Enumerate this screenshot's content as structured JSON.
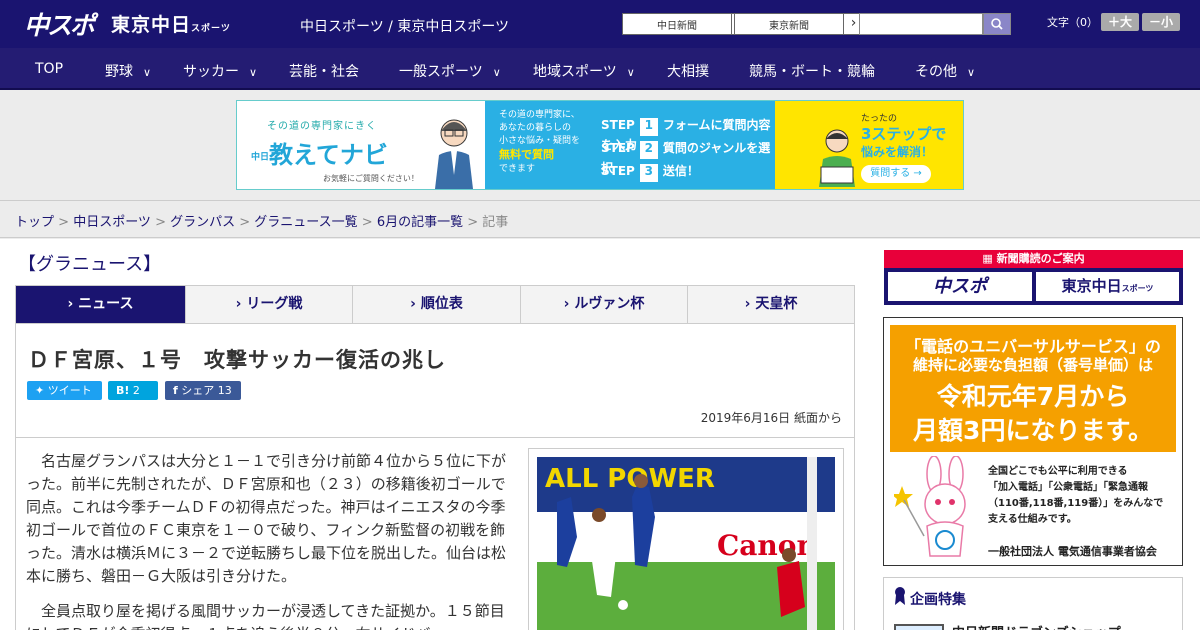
{
  "header": {
    "logo_main": "中スポ",
    "logo_tokyo": "東京中日",
    "logo_tokyo_small": "スポーツ",
    "site_title": "中日スポーツ / 東京中日スポーツ",
    "links": [
      {
        "label": "中日新聞"
      },
      {
        "label": "東京新聞"
      }
    ],
    "search": {
      "placeholder": ""
    },
    "font_size": {
      "label": "文字（0）",
      "bigger": "＋大",
      "smaller": "－小"
    }
  },
  "nav": {
    "items": [
      {
        "label": "TOP"
      },
      {
        "label": "野球"
      },
      {
        "label": "サッカー"
      },
      {
        "label": "芸能・社会"
      },
      {
        "label": "一般スポーツ"
      },
      {
        "label": "地域スポーツ"
      },
      {
        "label": "大相撲"
      },
      {
        "label": "競馬・ボート・競輪"
      },
      {
        "label": "その他"
      }
    ]
  },
  "banner": {
    "sub": "その道の専門家にきく",
    "logo_prefix": "中日",
    "logo": "教えてナビ",
    "note": "お気軽にご質問ください！",
    "desc_lines": [
      "その道の専門家に、",
      "あなたの暮らしの",
      "小さな悩み・疑問を"
    ],
    "desc_highlight": "無料で質問",
    "desc_end": "できます",
    "steps": [
      {
        "word": "STEP",
        "num": "1",
        "text": "フォームに質問内容を入力"
      },
      {
        "word": "STEP",
        "num": "2",
        "text": "質問のジャンルを選択"
      },
      {
        "word": "STEP",
        "num": "3",
        "text": "送信！"
      }
    ],
    "right_small": "たったの",
    "right_big": "3ステップで",
    "right_mid": "悩みを解消！",
    "right_button": "質問する →"
  },
  "breadcrumb": {
    "items": [
      "トップ",
      "中日スポーツ",
      "グランパス",
      "グラニュース一覧",
      "6月の記事一覧"
    ],
    "current": "記事",
    "sep": " > "
  },
  "section": {
    "title": "【グラニュース】"
  },
  "tabs": [
    {
      "label": "ニュース",
      "active": true
    },
    {
      "label": "リーグ戦"
    },
    {
      "label": "順位表"
    },
    {
      "label": "ルヴァン杯"
    },
    {
      "label": "天皇杯"
    }
  ],
  "article": {
    "headline": "ＤＦ宮原、１号　攻撃サッカー復活の兆し",
    "share": {
      "tweet": "ツイート",
      "hatena": "2",
      "facebook_label": "シェア",
      "facebook_count": "13"
    },
    "dateline": "2019年6月16日 紙面から",
    "paragraphs": [
      "名古屋グランパスは大分と１－１で引き分け前節４位から５位に下がった。前半に先制されたが、ＤＦ宮原和也（２３）の移籍後初ゴールで同点。これは今季チームＤＦの初得点だった。神戸はイニエスタの今季初ゴールで首位のＦＣ東京を１－０で破り、フィンク新監督の初戦を飾った。清水は横浜Ｍに３－２で逆転勝ちし最下位を脱出した。仙台は松本に勝ち、磐田－Ｇ大阪は引き分けた。",
      "全員点取り屋を掲げる風間サッカーが浸透してきた証拠か。１５節目にしてＤＦが今季初得点。１点を追う後半８分、右サイドバッ"
    ],
    "photo_text": {
      "board_left": "ALL POWER",
      "board_right": "Canon"
    }
  },
  "sidebar": {
    "subscribe_head": "新聞購読のご案内",
    "subscribe_buttons": [
      "中スポ",
      "東京中日"
    ],
    "subscribe_small": "スポーツ",
    "ad": {
      "line1": "「電話のユニバーサルサービス」の",
      "line2": "維持に必要な負担額（番号単価）は",
      "line3": "令和元年7月から",
      "line4": "月額3円になります。",
      "text_lines": [
        "全国どこでも公平に利用できる",
        "「加入電話」「公衆電話」「緊急通報",
        "（110番,118番,119番）」をみんなで",
        "支える仕組みです。"
      ],
      "org": "一般社団法人 電気通信事業者協会"
    },
    "feature": {
      "title": "企画特集",
      "item": "中日新聞ドラゴンズショップ"
    }
  },
  "colors": {
    "brand": "#1a1470",
    "accent_red": "#e8003a",
    "banner_blue": "#2ab0e4",
    "banner_yellow": "#ffe500",
    "ad_orange": "#f5a000"
  },
  "icons": [
    "search-icon",
    "chevron-down-icon",
    "chevron-right-icon",
    "twitter-icon",
    "hatena-icon",
    "facebook-icon",
    "newspaper-icon",
    "ribbon-icon"
  ]
}
